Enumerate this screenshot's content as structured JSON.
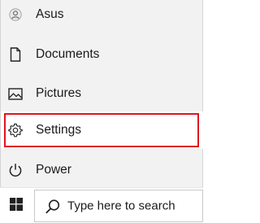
{
  "start_menu": {
    "items": [
      {
        "label": "Asus",
        "icon": "user-icon"
      },
      {
        "label": "Documents",
        "icon": "document-icon"
      },
      {
        "label": "Pictures",
        "icon": "pictures-icon"
      },
      {
        "label": "Settings",
        "icon": "gear-icon",
        "selected": true
      },
      {
        "label": "Power",
        "icon": "power-icon"
      }
    ]
  },
  "taskbar": {
    "start_icon": "windows-logo-icon",
    "search": {
      "placeholder": "Type here to search",
      "icon": "search-icon"
    }
  },
  "colors": {
    "highlight_border": "#e0141e",
    "menu_bg": "#f2f2f2"
  }
}
